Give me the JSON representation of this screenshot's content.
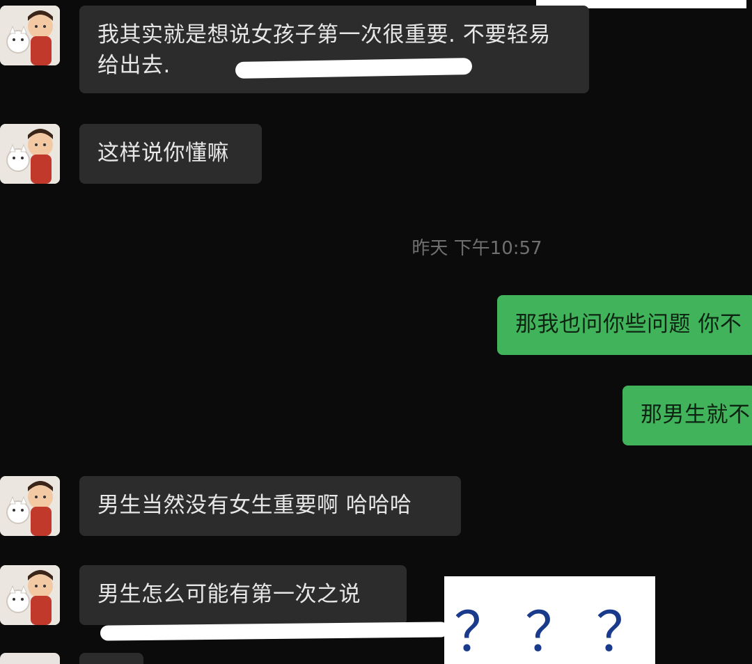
{
  "timestamp": "昨天 下午10:57",
  "messages": [
    {
      "side": "in",
      "text": "我其实就是想说女孩子第一次很重要. 不要轻易给出去."
    },
    {
      "side": "in",
      "text": "这样说你懂嘛"
    },
    {
      "side": "out",
      "text": "那我也问你些问题 你不"
    },
    {
      "side": "out",
      "text": "那男生就不"
    },
    {
      "side": "in",
      "text": "男生当然没有女生重要啊 哈哈哈"
    },
    {
      "side": "in",
      "text": "男生怎么可能有第一次之说"
    }
  ],
  "overlay": {
    "question_marks": "？？？"
  },
  "colors": {
    "background": "#0b0b0b",
    "incoming_bubble": "#2c2c2c",
    "outgoing_bubble": "#41b35b",
    "question_marks": "#1a3a8c"
  },
  "icons": {
    "avatar": "cartoon-couple-avatar"
  }
}
